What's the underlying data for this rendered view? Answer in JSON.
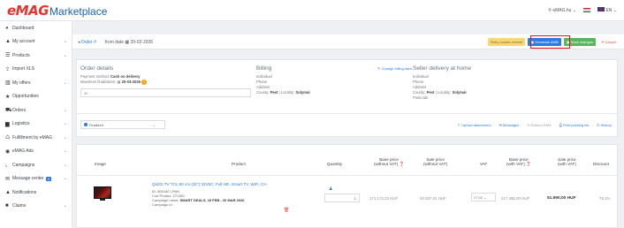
{
  "brand": {
    "logo_emag": "eMAG",
    "logo_marketplace": "Marketplace"
  },
  "topbar": {
    "store": "eMAG.hu",
    "language": "EN"
  },
  "sidebar": {
    "items": [
      {
        "label": "Dashboard",
        "icon": "dashboard-icon",
        "glyph": "◕"
      },
      {
        "label": "My account",
        "icon": "user-icon",
        "glyph": "▲",
        "chevron": "⌄"
      },
      {
        "label": "Products",
        "icon": "products-icon",
        "glyph": "☰",
        "chevron": "⌄"
      },
      {
        "label": "Import XLS",
        "icon": "import-icon",
        "glyph": "⇪"
      },
      {
        "label": "My offers",
        "icon": "offers-icon",
        "glyph": "▥",
        "chevron": "⌄"
      },
      {
        "label": "Opportunities",
        "icon": "star-icon",
        "glyph": "★"
      },
      {
        "label": "Orders",
        "icon": "cart-icon",
        "glyph": "⛟",
        "chevron": "⌄"
      },
      {
        "label": "Logistics",
        "icon": "truck-icon",
        "glyph": "▆",
        "chevron": "⌄"
      },
      {
        "label": "Fulfillment by eMAG",
        "icon": "fulfillment-icon",
        "glyph": "♺",
        "chevron": "⌄"
      },
      {
        "label": "eMAG Ads",
        "icon": "ads-icon",
        "glyph": "◉",
        "chevron": "⌄"
      },
      {
        "label": "Campaigns",
        "icon": "chart-icon",
        "glyph": "⌞",
        "chevron": "⌄"
      },
      {
        "label": "Message center",
        "icon": "mail-icon",
        "glyph": "✉",
        "chevron": "⌄",
        "badge": "5"
      },
      {
        "label": "Notifications",
        "icon": "bell-icon",
        "glyph": "▲"
      },
      {
        "label": "Claims",
        "icon": "claims-icon",
        "glyph": "■",
        "chevron": "⌄"
      }
    ]
  },
  "breadcrumb": {
    "order": "Order #",
    "from_label": "from date",
    "date": "20-02-2026"
  },
  "toolbar": {
    "courier_label": "Retry courier refresh",
    "generate_label": "Generate AWB",
    "save_label": "Save changes",
    "cancel_label": "Cancel"
  },
  "order_details": {
    "title": "Order details",
    "payment_label": "Payment method:",
    "payment_value": "Cash on delivery",
    "max_label": "Maximum finalization:",
    "max_date": "20-03-2026",
    "max_badge": "1",
    "observations": "30",
    "status": "Finalized"
  },
  "billing": {
    "title": "Billing",
    "change_label": "Change billing data",
    "lines": [
      "Individual",
      "Phone",
      "Address"
    ],
    "county_label": "County:",
    "county": "Pest",
    "locality_label": "Locality:",
    "locality": "Solymár"
  },
  "delivery": {
    "title": "Seller delivery at home",
    "lines": [
      "Individual",
      "Phone",
      "Address"
    ],
    "county_label": "County:",
    "county": "Pest",
    "locality_label": "Locality:",
    "locality": "Solymár",
    "postcode": "Postcode"
  },
  "actions": {
    "upload": "Upload attachment",
    "messages": "Messages",
    "refund": "Refund RMA",
    "print": "Print packing list",
    "history": "History"
  },
  "table": {
    "headers": {
      "image": "Image",
      "product": "Product",
      "quantity": "Quantity",
      "base_excl_1": "Base price",
      "base_excl_2": "(without VAT)",
      "sale_excl_1": "Sale price",
      "sale_excl_2": "(without VAT)",
      "vat": "VAT",
      "base_incl_1": "Base price",
      "base_incl_2": "(with VAT)",
      "sale_incl_1": "Sale price",
      "sale_incl_2": "(with VAT)",
      "discount": "Discount"
    },
    "row": {
      "title": "QLED TV TCL 80 cm (32\") 32V5C, Full HD, Smart TV, WiFi, CI+",
      "id_line": "ID: 800160 | PNK:",
      "cod_line": "Cod Produs: 271360",
      "campaign_label": "Campaign name:",
      "campaign": "SMART DEALS, 19 FEB - 20 MAR 2026",
      "campaign_id": "Campaign id:",
      "quantity": "1",
      "base_excl": "171 173,23 HUF",
      "sale_excl": "40 937,01 HUF",
      "vat": "27.00",
      "base_incl": "217 390,00 HUF",
      "sale_incl": "51.990,00 HUF",
      "discount": "76.1%"
    }
  }
}
